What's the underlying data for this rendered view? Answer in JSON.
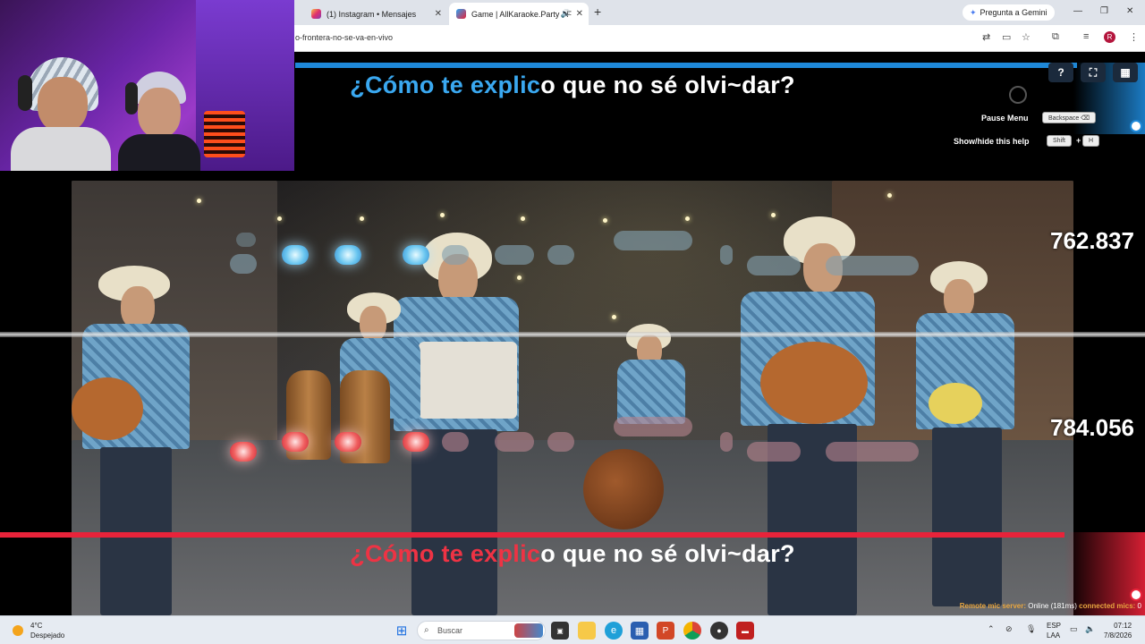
{
  "browser": {
    "tabs": [
      {
        "label": "(1) Instagram • Mensajes",
        "active": false
      },
      {
        "label": "Game | AllKaraoke.Party - F",
        "active": true
      }
    ],
    "new_tab_symbol": "+",
    "gemini_label": "Pregunta a Gemini",
    "address": "o-frontera-no-se-va-en-vivo",
    "profile_initial": "R"
  },
  "game": {
    "lyric_top": {
      "highlighted": "¿Cómo te explic",
      "rest": "o que no sé olvi~dar?"
    },
    "lyric_bottom": {
      "highlighted": "¿Cómo te explic",
      "rest": "o que no sé olvi~dar?"
    },
    "score_player1": "762.837",
    "score_player2": "784.056",
    "help": {
      "pause_menu_label": "Pause Menu",
      "pause_key": "Backspace ⌫",
      "toggle_help_label": "Show/hide this help",
      "toggle_key": "Shift",
      "toggle_key_plus": "+",
      "toggle_key2": "H"
    },
    "top_buttons": [
      "?",
      "⛶",
      "▦"
    ],
    "remote_mic": {
      "label": "Remote mic server:",
      "status": "Online (181ms)",
      "connected_label": "connected mics:",
      "connected_count": "0"
    },
    "progress_top": 0.92,
    "progress_bottom": 0.93
  },
  "taskbar": {
    "weather_temp": "4°C",
    "weather_desc": "Despejado",
    "search_placeholder": "Buscar",
    "lang1": "ESP",
    "lang2": "LAA",
    "time": "07:12",
    "date": "7/8/2026"
  },
  "colors": {
    "accent_blue": "#1e88d8",
    "accent_red": "#e8233a",
    "lyric_blue": "#3aa8f0",
    "lyric_red": "#ee3344"
  }
}
